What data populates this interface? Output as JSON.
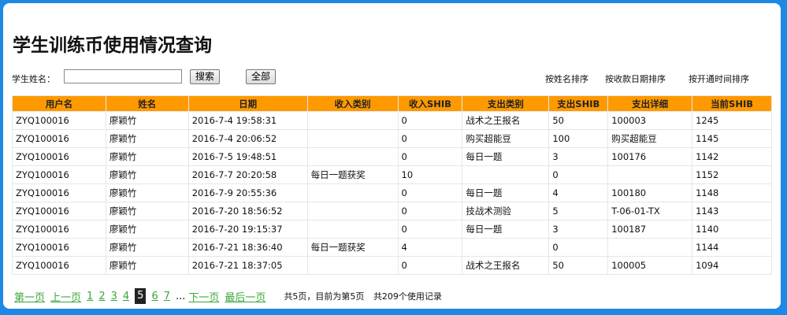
{
  "page": {
    "title": "学生训练币使用情况查询"
  },
  "search": {
    "label": "学生姓名：",
    "value": "",
    "placeholder": "",
    "search_button": "搜索",
    "all_button": "全部"
  },
  "sort": {
    "by_name": "按姓名排序",
    "by_date": "按收款日期排序",
    "by_open": "按开通时间排序"
  },
  "table": {
    "headers": [
      "用户名",
      "姓名",
      "日期",
      "收入类别",
      "收入SHIB",
      "支出类别",
      "支出SHIB",
      "支出详细",
      "当前SHIB"
    ],
    "rows": [
      [
        "ZYQ100016",
        "廖颖竹",
        "2016-7-4 19:58:31",
        "",
        "0",
        "战术之王报名",
        "50",
        "100003",
        "1245"
      ],
      [
        "ZYQ100016",
        "廖颖竹",
        "2016-7-4 20:06:52",
        "",
        "0",
        "购买超能豆",
        "100",
        "购买超能豆",
        "1145"
      ],
      [
        "ZYQ100016",
        "廖颖竹",
        "2016-7-5 19:48:51",
        "",
        "0",
        "每日一题",
        "3",
        "100176",
        "1142"
      ],
      [
        "ZYQ100016",
        "廖颖竹",
        "2016-7-7 20:20:58",
        "每日一题获奖",
        "10",
        "",
        "0",
        "",
        "1152"
      ],
      [
        "ZYQ100016",
        "廖颖竹",
        "2016-7-9 20:55:36",
        "",
        "0",
        "每日一题",
        "4",
        "100180",
        "1148"
      ],
      [
        "ZYQ100016",
        "廖颖竹",
        "2016-7-20 18:56:52",
        "",
        "0",
        "技战术测验",
        "5",
        "T-06-01-TX",
        "1143"
      ],
      [
        "ZYQ100016",
        "廖颖竹",
        "2016-7-20 19:15:37",
        "",
        "0",
        "每日一题",
        "3",
        "100187",
        "1140"
      ],
      [
        "ZYQ100016",
        "廖颖竹",
        "2016-7-21 18:36:40",
        "每日一题获奖",
        "4",
        "",
        "0",
        "",
        "1144"
      ],
      [
        "ZYQ100016",
        "廖颖竹",
        "2016-7-21 18:37:05",
        "",
        "0",
        "战术之王报名",
        "50",
        "100005",
        "1094"
      ]
    ]
  },
  "pager": {
    "first": "第一页",
    "prev": "上一页",
    "pages": [
      "1",
      "2",
      "3",
      "4",
      "5",
      "6",
      "7"
    ],
    "current": "5",
    "ellipsis": "...",
    "next": "下一页",
    "last": "最后一页",
    "summary_pages": "共5页，目前为第5页",
    "summary_count": "共209个使用记录"
  },
  "colors": {
    "background": "#1e88e5",
    "header": "#ff9900",
    "link": "#3aa63a"
  }
}
